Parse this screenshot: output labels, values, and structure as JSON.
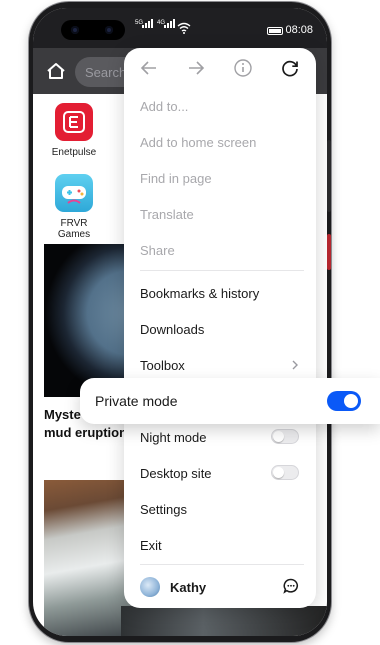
{
  "status_bar": {
    "sim1": "5G",
    "sim2": "4G",
    "time": "08:08"
  },
  "browser": {
    "search_placeholder": "Search"
  },
  "tiles": [
    {
      "label": "Enetpulse",
      "icon": "enetpulse-icon",
      "color": "#e31e33"
    },
    {
      "label": "FRVR Games",
      "icon": "gamepad-icon",
      "color": "#3ec3e8"
    }
  ],
  "news": {
    "headline_line1": "Myste",
    "headline_line2": "mud eruptions"
  },
  "menu": {
    "nav": [
      "back-icon",
      "forward-icon",
      "info-icon",
      "refresh-icon"
    ],
    "disabled_items": [
      "Add to...",
      "Add to home screen",
      "Find in page",
      "Translate",
      "Share"
    ],
    "items": [
      "Bookmarks & history",
      "Downloads",
      "Toolbox"
    ],
    "private_mode": {
      "label": "Private mode",
      "on": true
    },
    "night_mode": {
      "label": "Night mode",
      "on": false
    },
    "desktop_site": {
      "label": "Desktop site",
      "on": false
    },
    "settings": "Settings",
    "exit": "Exit",
    "account": {
      "name": "Kathy"
    }
  },
  "colors": {
    "accent": "#0a59f7",
    "disabled_text": "#a8a8ac"
  }
}
